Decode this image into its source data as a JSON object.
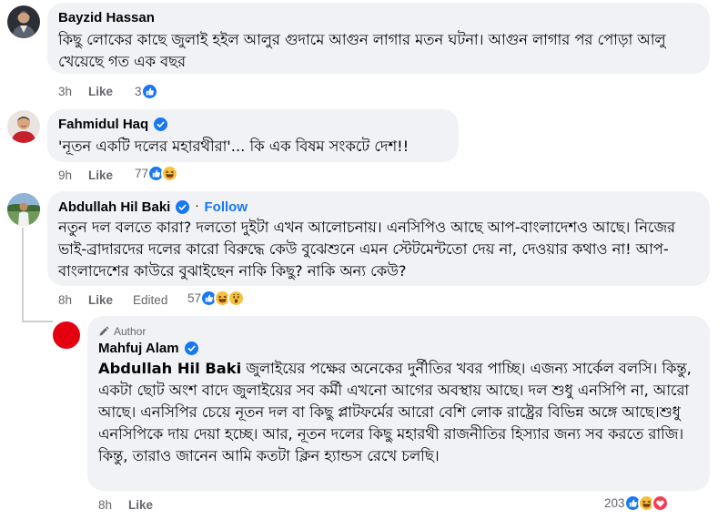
{
  "comments": [
    {
      "name": "Bayzid Hassan",
      "text": "কিছু লোকের কাছে জুলাই হইল আলুর গুদামে আগুন লাগার মতন ঘটনা। আগুন লাগার পর পোড়া আলু খেয়েছে গত এক বছর",
      "time": "3h",
      "like_label": "Like",
      "reaction_count": "3",
      "reactions": [
        "like-reaction-icon"
      ]
    },
    {
      "name": "Fahmidul Haq",
      "verified": true,
      "text": "'নূতন একটি দলের মহারথীরা'... কি এক বিষম সংকটে দেশ!!",
      "time": "9h",
      "like_label": "Like",
      "reaction_count": "77",
      "reactions": [
        "like-reaction-icon",
        "haha-reaction-icon"
      ]
    },
    {
      "name": "Abdullah Hil Baki",
      "verified": true,
      "separator": "·",
      "follow_label": "Follow",
      "text": "নতুন দল বলতে কারা? দলতো দুইটা এখন আলোচনায়। এনসিপিও আছে আপ-বাংলাদেশও আছে। নিজের ভাই-ব্রাদারদের দলের কারো বিরুদ্ধে কেউ বুঝেশুনে এমন স্টেটমেন্টতো দেয় না, দেওয়ার কথাও না! আপ-বাংলাদেশের কাউরে বুঝাইছেন নাকি কিছু? নাকি অন্য কেউ?",
      "time": "8h",
      "like_label": "Like",
      "edited_label": "Edited",
      "reaction_count": "57",
      "reactions": [
        "like-reaction-icon",
        "haha-reaction-icon",
        "wow-reaction-icon"
      ]
    }
  ],
  "reply": {
    "author_tag": "Author",
    "name": "Mahfuj Alam",
    "verified": true,
    "mention": "Abdullah Hil Baki",
    "text": " জুলাইয়ের পক্ষের অনেকের দুর্নীতির খবর পাচ্ছি। এজন্য সার্কেল বলসি। কিন্তু, একটা ছোট অংশ বাদে জুলাইয়ের সব কর্মী এখনো আগের অবস্থায় আছে। দল শুধু এনসিপি না, আরো আছে। এনসিপির চেয়ে নূতন দল বা কিছু প্লাটফর্মের আরো বেশি লোক রাষ্ট্রের বিভিন্ন অঙ্গে আছে।শুধু এনসিপিকে দায় দেয়া হচ্ছে। আর, নূতন দলের কিছু মহারথী রাজনীতির হিস্যার জন্য সব করতে রাজি। কিন্তু, তারাও জানেন আমি কতটা ক্লিন হ্যান্ডস রেখে চলছি।",
    "time": "8h",
    "like_label": "Like",
    "reaction_count": "203",
    "reactions": [
      "like-reaction-icon",
      "haha-reaction-icon",
      "love-reaction-icon"
    ]
  },
  "colors": {
    "bubble": "#f0f2f5",
    "link": "#1877f2",
    "meta": "#65676b",
    "reply_avatar": "#e4000f"
  }
}
